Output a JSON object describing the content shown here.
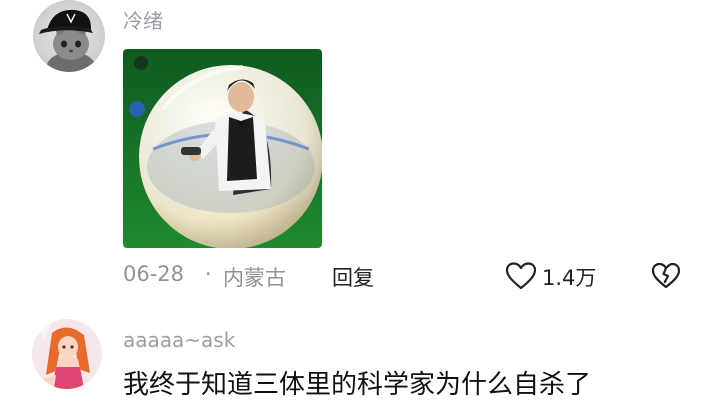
{
  "comments": [
    {
      "username": "冷绪",
      "date": "06-28",
      "separator": "·",
      "location": "内蒙古",
      "reply_label": "回复",
      "like_count": "1.4万"
    },
    {
      "username": "aaaaa~ask",
      "text": "我终于知道三体里的科学家为什么自杀了"
    }
  ],
  "colors": {
    "meta_gray": "#8f9297",
    "username_gray": "#9a9da3",
    "text_dark": "#111111",
    "table_green": "#1f7a2e"
  },
  "icons": [
    "heart-outline-icon",
    "broken-heart-icon"
  ]
}
